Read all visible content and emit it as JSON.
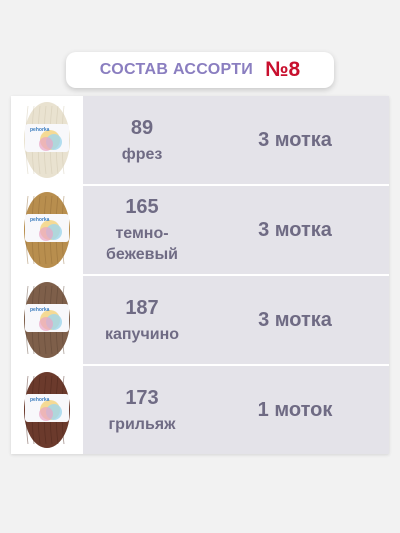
{
  "header": {
    "title": "СОСТАВ АССОРТИ",
    "number": "№8"
  },
  "items": [
    {
      "code": "89",
      "color_name": "фрез",
      "quantity": "3 мотка",
      "yarn_color": "#e9e2d0",
      "yarn_shadow": "#cfc5ad"
    },
    {
      "code": "165",
      "color_name": "темно-бежевый",
      "quantity": "3 мотка",
      "yarn_color": "#b88e4e",
      "yarn_shadow": "#8f6a35"
    },
    {
      "code": "187",
      "color_name": "капучино",
      "quantity": "3 мотка",
      "yarn_color": "#7e5f4a",
      "yarn_shadow": "#5a4131"
    },
    {
      "code": "173",
      "color_name": "грильяж",
      "quantity": "1 моток",
      "yarn_color": "#6b3a2c",
      "yarn_shadow": "#4a2419"
    }
  ],
  "label": {
    "brand": "pehorka"
  }
}
